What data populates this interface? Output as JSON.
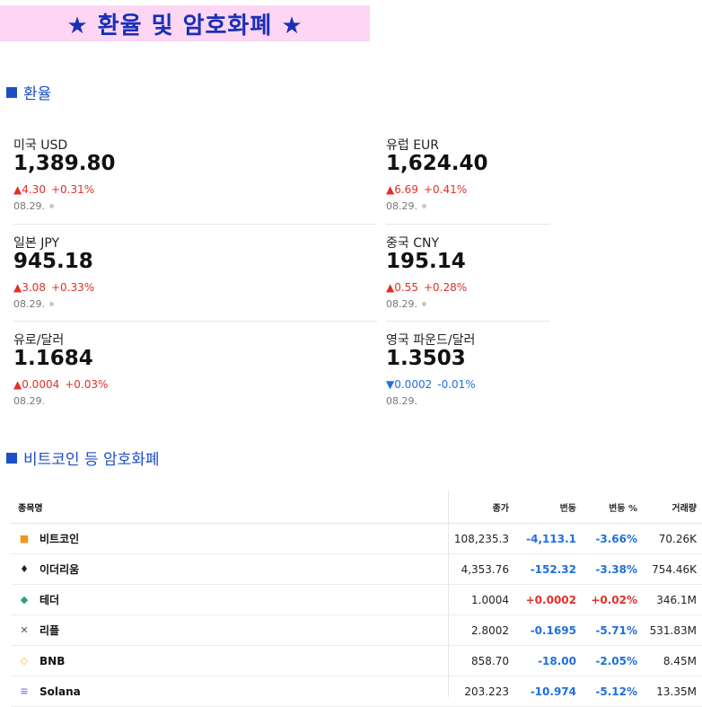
{
  "banner": {
    "title": "★ 환율 및 암호화폐 ★"
  },
  "sections": {
    "fx_title": "환율",
    "crypto_title": "비트코인 등 암호화폐"
  },
  "colors": {
    "up": "#e0302a",
    "down": "#1f6fe0",
    "accent": "#1d4fc4",
    "banner_bg": "#fcd6f3"
  },
  "fx": [
    {
      "name": "미국 USD",
      "value": "1,389.80",
      "dir": "up",
      "arrow": "▲",
      "change": "4.30",
      "percent": "+0.31%",
      "date": "08.29."
    },
    {
      "name": "유럽 EUR",
      "value": "1,624.40",
      "dir": "up",
      "arrow": "▲",
      "change": "6.69",
      "percent": "+0.41%",
      "date": "08.29."
    },
    {
      "name": "일본 JPY",
      "value": "945.18",
      "dir": "up",
      "arrow": "▲",
      "change": "3.08",
      "percent": "+0.33%",
      "date": "08.29."
    },
    {
      "name": "중국 CNY",
      "value": "195.14",
      "dir": "up",
      "arrow": "▲",
      "change": "0.55",
      "percent": "+0.28%",
      "date": "08.29."
    },
    {
      "name": "유로/달러",
      "value": "1.1684",
      "dir": "up",
      "arrow": "▲",
      "change": "0.0004",
      "percent": "+0.03%",
      "date": "08.29."
    },
    {
      "name": "영국 파운드/달러",
      "value": "1.3503",
      "dir": "down",
      "arrow": "▼",
      "change": "0.0002",
      "percent": "-0.01%",
      "date": "08.29."
    }
  ],
  "crypto": {
    "headers": {
      "name": "종목명",
      "price": "종가",
      "change": "변동",
      "percent": "변동 %",
      "volume": "거래량"
    },
    "rows": [
      {
        "icon": "bitcoin-icon",
        "glyph": "■",
        "glyph_color": "#f7931a",
        "name": "비트코인",
        "price": "108,235.3",
        "change": "-4,113.1",
        "percent": "-3.66%",
        "volume": "70.26K",
        "dir": "neg"
      },
      {
        "icon": "ethereum-icon",
        "glyph": "♦",
        "glyph_color": "#222222",
        "name": "이더리움",
        "price": "4,353.76",
        "change": "-152.32",
        "percent": "-3.38%",
        "volume": "754.46K",
        "dir": "neg"
      },
      {
        "icon": "tether-icon",
        "glyph": "◆",
        "glyph_color": "#26a17b",
        "name": "테더",
        "price": "1.0004",
        "change": "+0.0002",
        "percent": "+0.02%",
        "volume": "346.1M",
        "dir": "pos"
      },
      {
        "icon": "ripple-icon",
        "glyph": "✕",
        "glyph_color": "#555555",
        "name": "리플",
        "price": "2.8002",
        "change": "-0.1695",
        "percent": "-5.71%",
        "volume": "531.83M",
        "dir": "neg"
      },
      {
        "icon": "bnb-icon",
        "glyph": "◇",
        "glyph_color": "#f3ba2f",
        "name": "BNB",
        "price": "858.70",
        "change": "-18.00",
        "percent": "-2.05%",
        "volume": "8.45M",
        "dir": "neg"
      },
      {
        "icon": "solana-icon",
        "glyph": "≡",
        "glyph_color": "#8a7df0",
        "name": "Solana",
        "price": "203.223",
        "change": "-10.974",
        "percent": "-5.12%",
        "volume": "13.35M",
        "dir": "neg"
      }
    ]
  }
}
